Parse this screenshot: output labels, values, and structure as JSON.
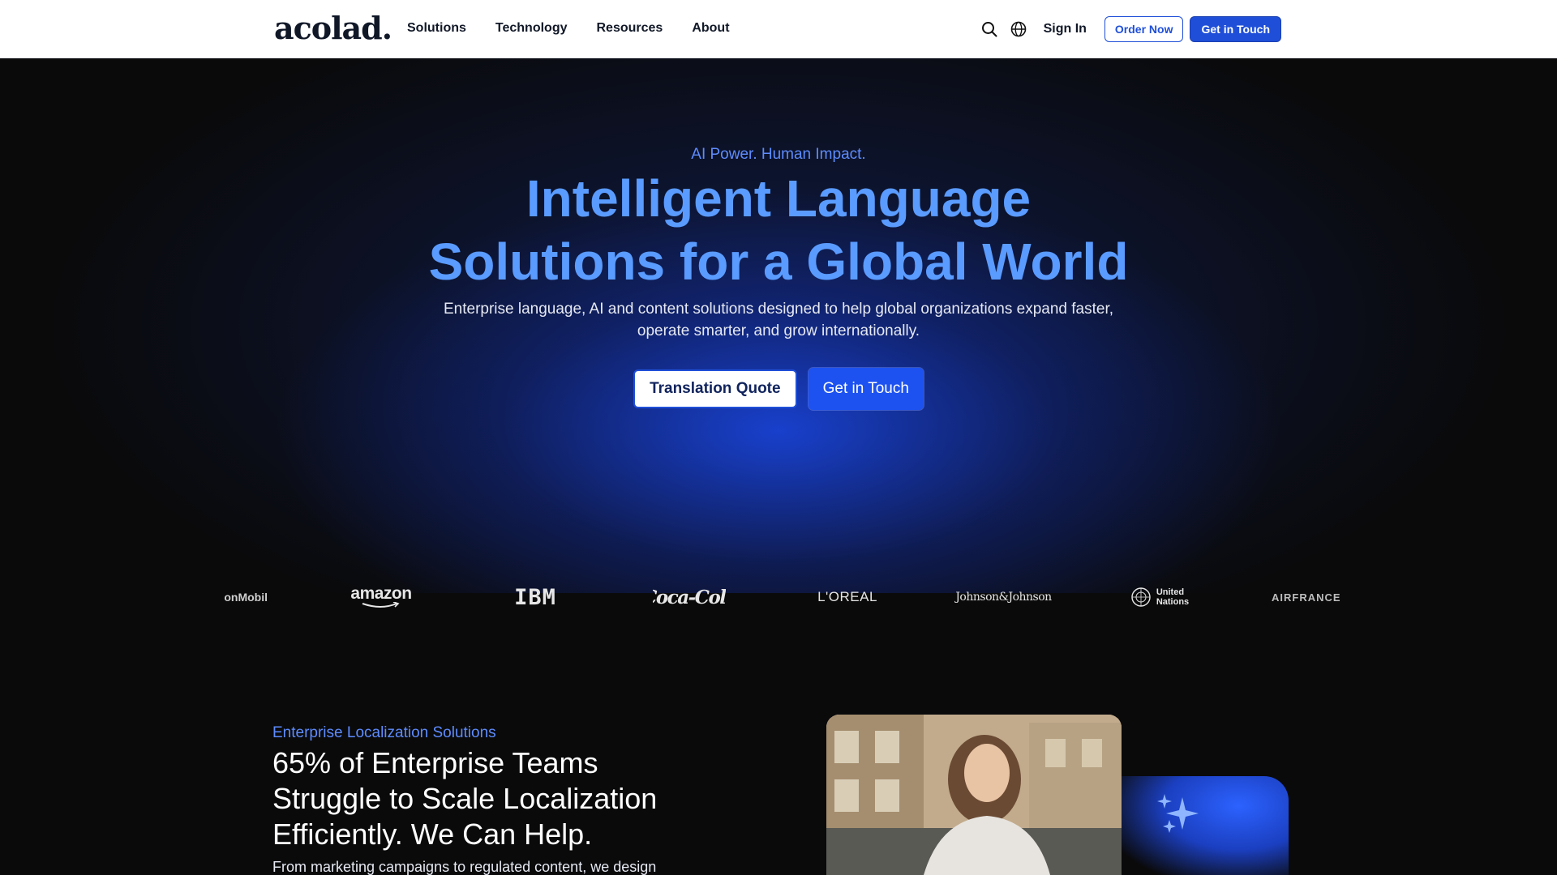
{
  "header": {
    "logo": "acolad.",
    "nav": [
      "Solutions",
      "Technology",
      "Resources",
      "About"
    ],
    "sign_in": "Sign In",
    "order_now": "Order Now",
    "get_in_touch": "Get in Touch",
    "icons": [
      "search-icon",
      "globe-icon"
    ]
  },
  "hero": {
    "eyebrow": "AI Power. Human Impact.",
    "headline_line1": "Intelligent Language",
    "headline_line2": "Solutions for a Global World",
    "subtitle": "Enterprise language, AI and content solutions designed to help global organizations expand faster, operate smarter, and grow internationally.",
    "btn_quote": "Translation Quote",
    "btn_touch": "Get in Touch"
  },
  "clients": [
    "ExxonMobil",
    "amazon",
    "IBM",
    "Coca-Cola",
    "L'OREAL",
    "Johnson&Johnson",
    "United Nations",
    "AIRFRANCE"
  ],
  "clients_visible_text": {
    "exxon": "onMobil",
    "un_line1": "United",
    "un_line2": "Nations",
    "airfrance": "AIRFRANCE"
  },
  "section": {
    "eyebrow": "Enterprise Localization Solutions",
    "title_line1": "65% of Enterprise Teams",
    "title_line2": "Struggle to Scale Localization",
    "title_line3": "Efficiently. We Can Help.",
    "text": "From marketing campaigns to regulated content, we design"
  },
  "colors": {
    "accent": "#1f4fd8",
    "headline": "#5a9bff",
    "eyebrow": "#5e8cff",
    "background": "#0a0a0b"
  }
}
